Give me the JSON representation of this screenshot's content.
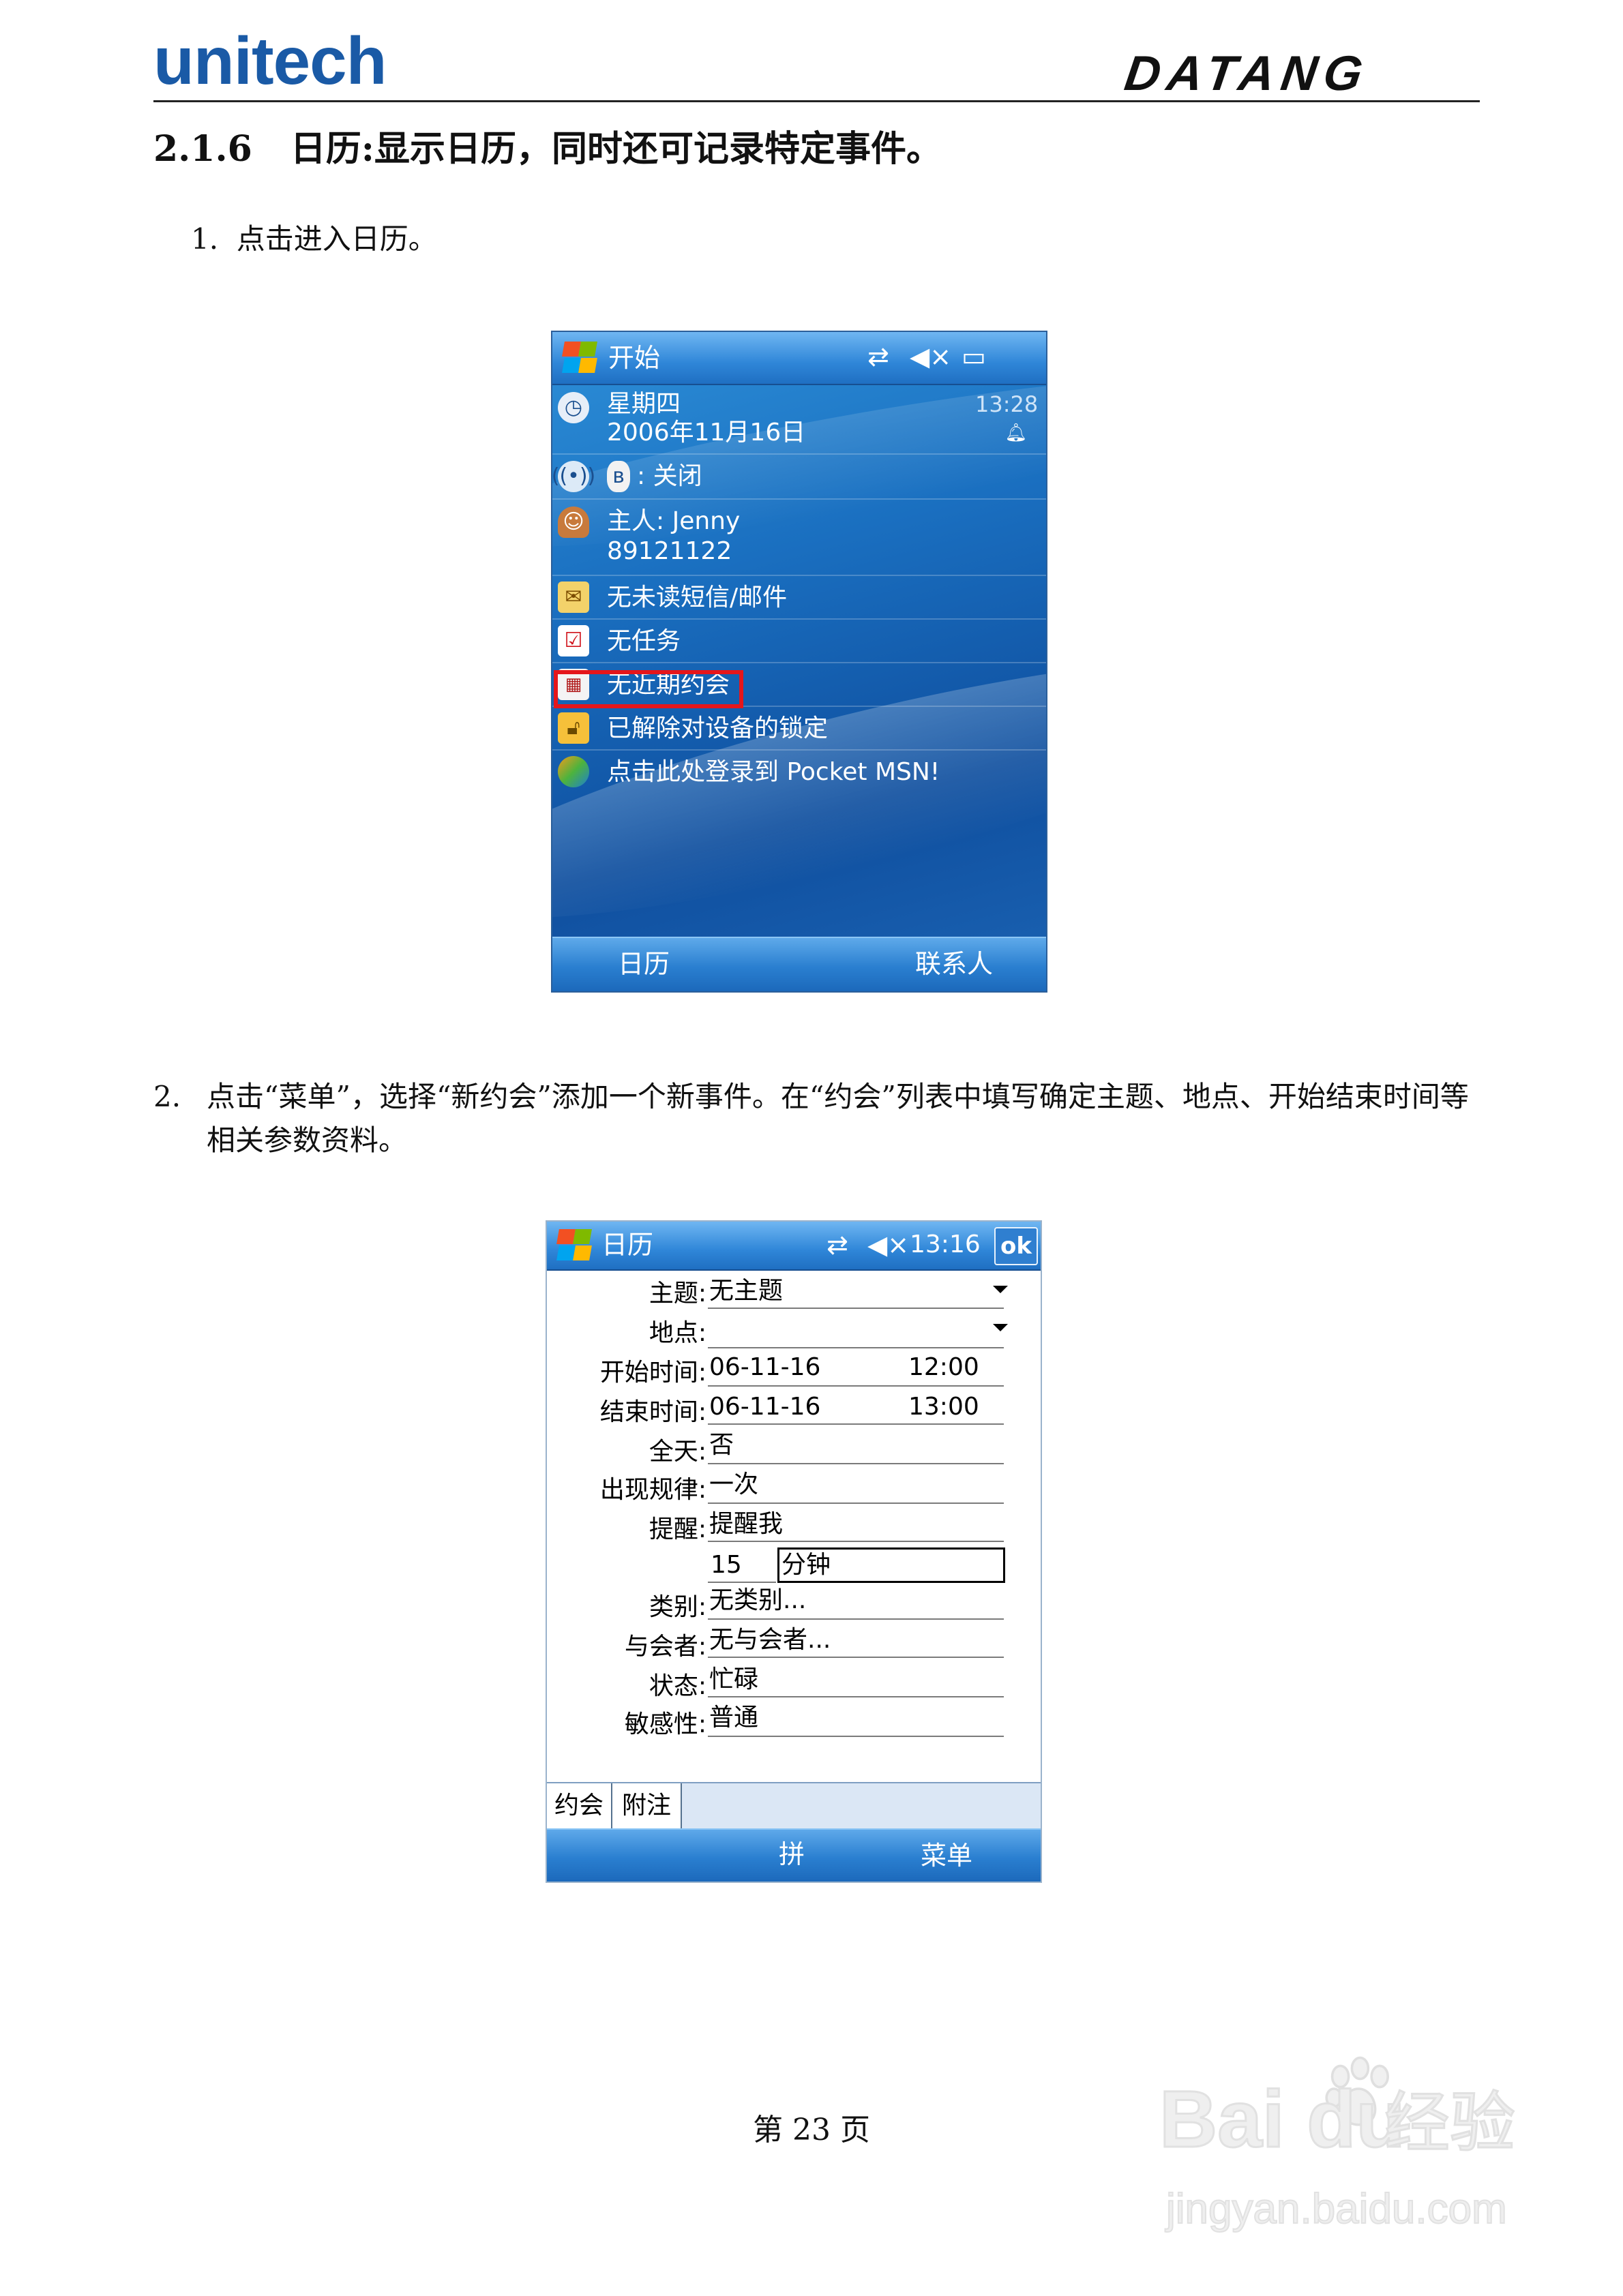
{
  "header": {
    "left_logo": "unitech",
    "right_logo": "DATANG"
  },
  "section": {
    "number": "2.1.6",
    "title": "日历:显示日历，同时还可记录特定事件。"
  },
  "steps": [
    {
      "num": "1.",
      "text": "点击进入日历。"
    },
    {
      "num": "2.",
      "text": "点击“菜单”，选择“新约会”添加一个新事件。在“约会”列表中填写确定主题、地点、开始结束时间等相关参数资料。"
    }
  ],
  "screen1": {
    "title": "开始",
    "status_icons": [
      "sync-icon",
      "speaker-muted-icon",
      "battery-icon"
    ],
    "today": {
      "weekday": "星期四",
      "date": "2006年11月16日",
      "time": "13:28"
    },
    "bluetooth": ": 关闭",
    "owner": {
      "name": "主人: Jenny",
      "phone": "89121122"
    },
    "messages": "无未读短信/邮件",
    "tasks": "无任务",
    "appointments": "无近期约会",
    "lock": "已解除对设备的锁定",
    "msn": "点击此处登录到 Pocket MSN!",
    "softkeys": {
      "left": "日历",
      "right": "联系人"
    }
  },
  "screen2": {
    "title": "日历",
    "time": "13:16",
    "ok": "ok",
    "fields": [
      {
        "label": "主题:",
        "value": "无主题"
      },
      {
        "label": "地点:",
        "value": ""
      },
      {
        "label": "开始时间:",
        "value": "06-11-16",
        "value2": "12:00"
      },
      {
        "label": "结束时间:",
        "value": "06-11-16",
        "value2": "13:00"
      },
      {
        "label": "全天:",
        "value": "否"
      },
      {
        "label": "出现规律:",
        "value": "一次"
      },
      {
        "label": "提醒:",
        "value": "提醒我"
      },
      {
        "label": "",
        "value": "15",
        "value2": "分钟"
      },
      {
        "label": "类别:",
        "value": "无类别..."
      },
      {
        "label": "与会者:",
        "value": "无与会者..."
      },
      {
        "label": "状态:",
        "value": "忙碌"
      },
      {
        "label": "敏感性:",
        "value": "普通"
      }
    ],
    "tabs": [
      "约会",
      "附注"
    ],
    "softkeys": {
      "center": "拼",
      "right": "菜单"
    }
  },
  "footer": {
    "page": "第 23 页"
  },
  "watermark": {
    "brand": "Bai du",
    "brand_cn": "经验",
    "url": "jingyan.baidu.com"
  },
  "colors": {
    "brand_blue": "#1a5aa6",
    "highlight_red": "#e5161b",
    "wm_blue": "#2f7fd0"
  }
}
